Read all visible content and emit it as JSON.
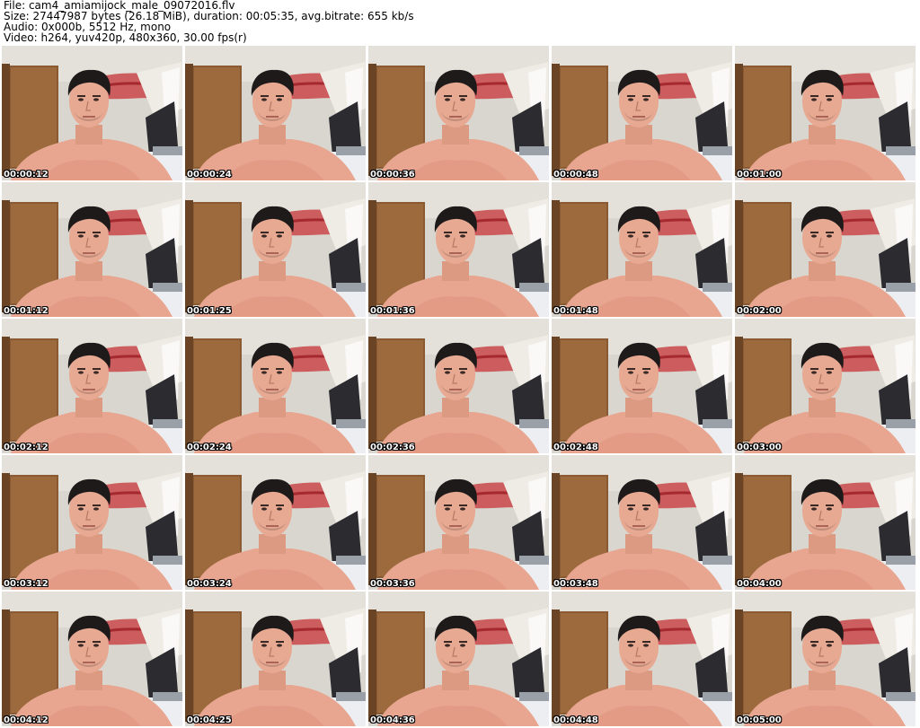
{
  "info": {
    "file": "File: cam4_amiamijock_male_09072016.flv",
    "size": "Size: 27447987 bytes (26.18 MiB), duration: 00:05:35, avg.bitrate: 655 kb/s",
    "audio": "Audio: 0x000b, 5512 Hz, mono",
    "video": "Video: h264, yuv420p, 480x360, 30.00 fps(r)"
  },
  "thumbnails": [
    "00:00:12",
    "00:00:24",
    "00:00:36",
    "00:00:48",
    "00:01:00",
    "00:01:12",
    "00:01:25",
    "00:01:36",
    "00:01:48",
    "00:02:00",
    "00:02:12",
    "00:02:24",
    "00:02:36",
    "00:02:48",
    "00:03:00",
    "00:03:12",
    "00:03:24",
    "00:03:36",
    "00:03:48",
    "00:04:00",
    "00:04:12",
    "00:04:25",
    "00:04:36",
    "00:04:48",
    "00:05:00"
  ]
}
